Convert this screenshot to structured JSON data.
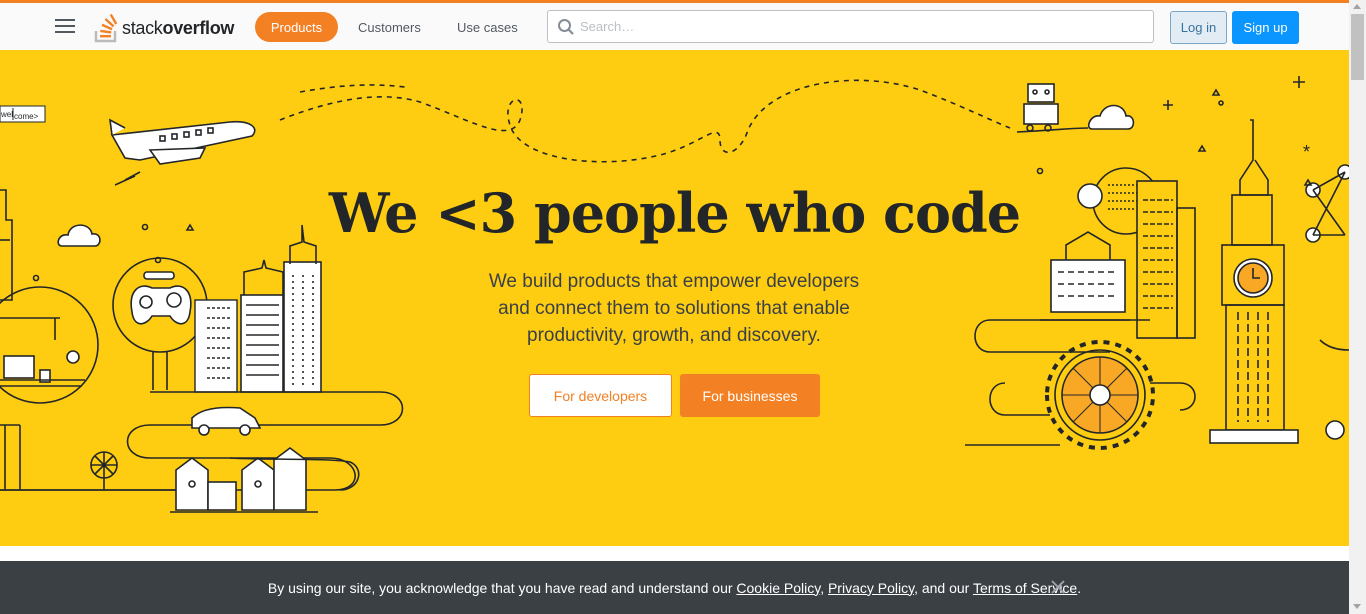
{
  "header": {
    "logo_text_light": "stack",
    "logo_text_bold": "overflow",
    "nav": {
      "products": "Products",
      "customers": "Customers",
      "use_cases": "Use cases"
    },
    "search": {
      "placeholder": "Search…",
      "value": ""
    },
    "login": "Log in",
    "signup": "Sign up"
  },
  "hero": {
    "title": "We <3 people who code",
    "subtitle_lines": [
      "We build products that empower developers",
      "and connect them to solutions that enable",
      "productivity, growth, and discovery."
    ],
    "cta_developers": "For developers",
    "cta_businesses": "For businesses",
    "sign_text_1": "wel",
    "sign_text_2": "come>"
  },
  "cookie_banner": {
    "text_before": "By using our site, you acknowledge that you have read and understand our ",
    "cookie_policy": "Cookie Policy",
    "sep1": ", ",
    "privacy_policy": "Privacy Policy",
    "sep2": ", and our ",
    "terms": "Terms of Service",
    "end": "."
  },
  "icons": {
    "menu": "hamburger-icon",
    "search": "search-icon",
    "close": "close-icon",
    "logo": "stackoverflow-logo-icon"
  },
  "colors": {
    "brand_orange": "#f48024",
    "hero_yellow": "#fecd12",
    "signup_blue": "#0a95ff",
    "cookie_bg": "#3b4045"
  }
}
